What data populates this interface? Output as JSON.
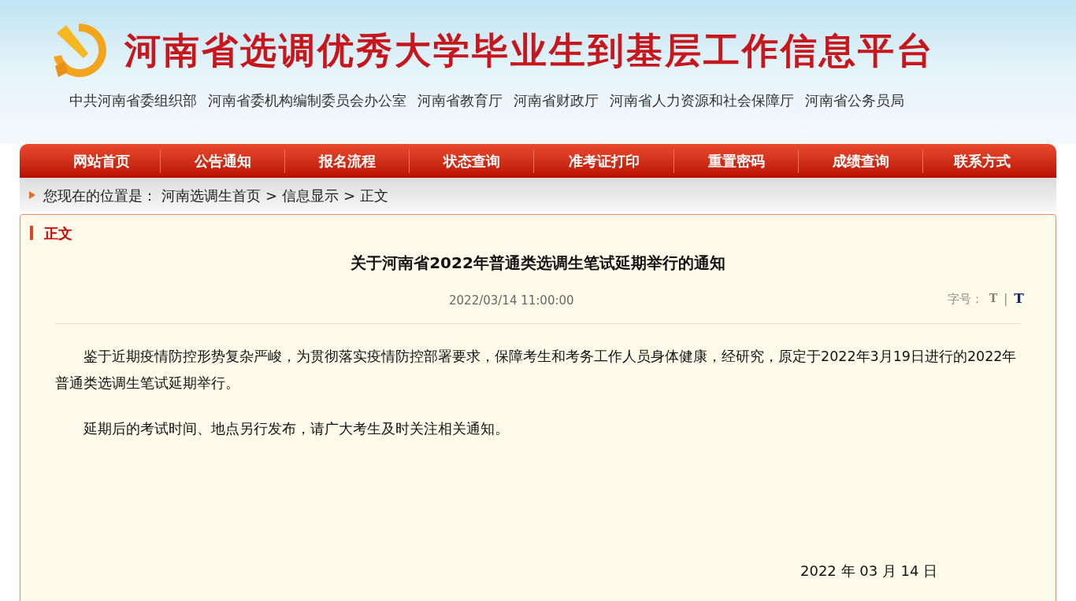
{
  "banner": {
    "title": "河南省选调优秀大学毕业生到基层工作信息平台",
    "organizations": [
      "中共河南省委组织部",
      "河南省委机构编制委员会办公室",
      "河南省教育厅",
      "河南省财政厅",
      "河南省人力资源和社会保障厅",
      "河南省公务员局"
    ]
  },
  "nav": [
    {
      "label": "网站首页"
    },
    {
      "label": "公告通知"
    },
    {
      "label": "报名流程"
    },
    {
      "label": "状态查询"
    },
    {
      "label": "准考证打印"
    },
    {
      "label": "重置密码"
    },
    {
      "label": "成绩查询"
    },
    {
      "label": "联系方式"
    }
  ],
  "breadcrumb": {
    "prefix": "您现在的位置是：",
    "items": [
      "河南选调生首页",
      "信息显示",
      "正文"
    ],
    "separator": ">"
  },
  "panel": {
    "heading": "正文",
    "title": "关于河南省2022年普通类选调生笔试延期举行的通知",
    "date": "2022/03/14 11:00:00",
    "font_size_label": "字号：",
    "font_size_options": [
      {
        "label": "T",
        "selected": false
      },
      {
        "label": "T",
        "selected": true
      }
    ],
    "font_size_separator": "|",
    "paragraphs": [
      "鉴于近期疫情防控形势复杂严峻，为贯彻落实疫情防控部署要求，保障考生和考务工作人员身体健康，经研究，原定于2022年3月19日进行的2022年普通类选调生笔试延期举行。",
      "延期后的考试时间、地点另行发布，请广大考生及时关注相关通知。"
    ],
    "signature_date": "2022 年 03 月 14 日"
  }
}
